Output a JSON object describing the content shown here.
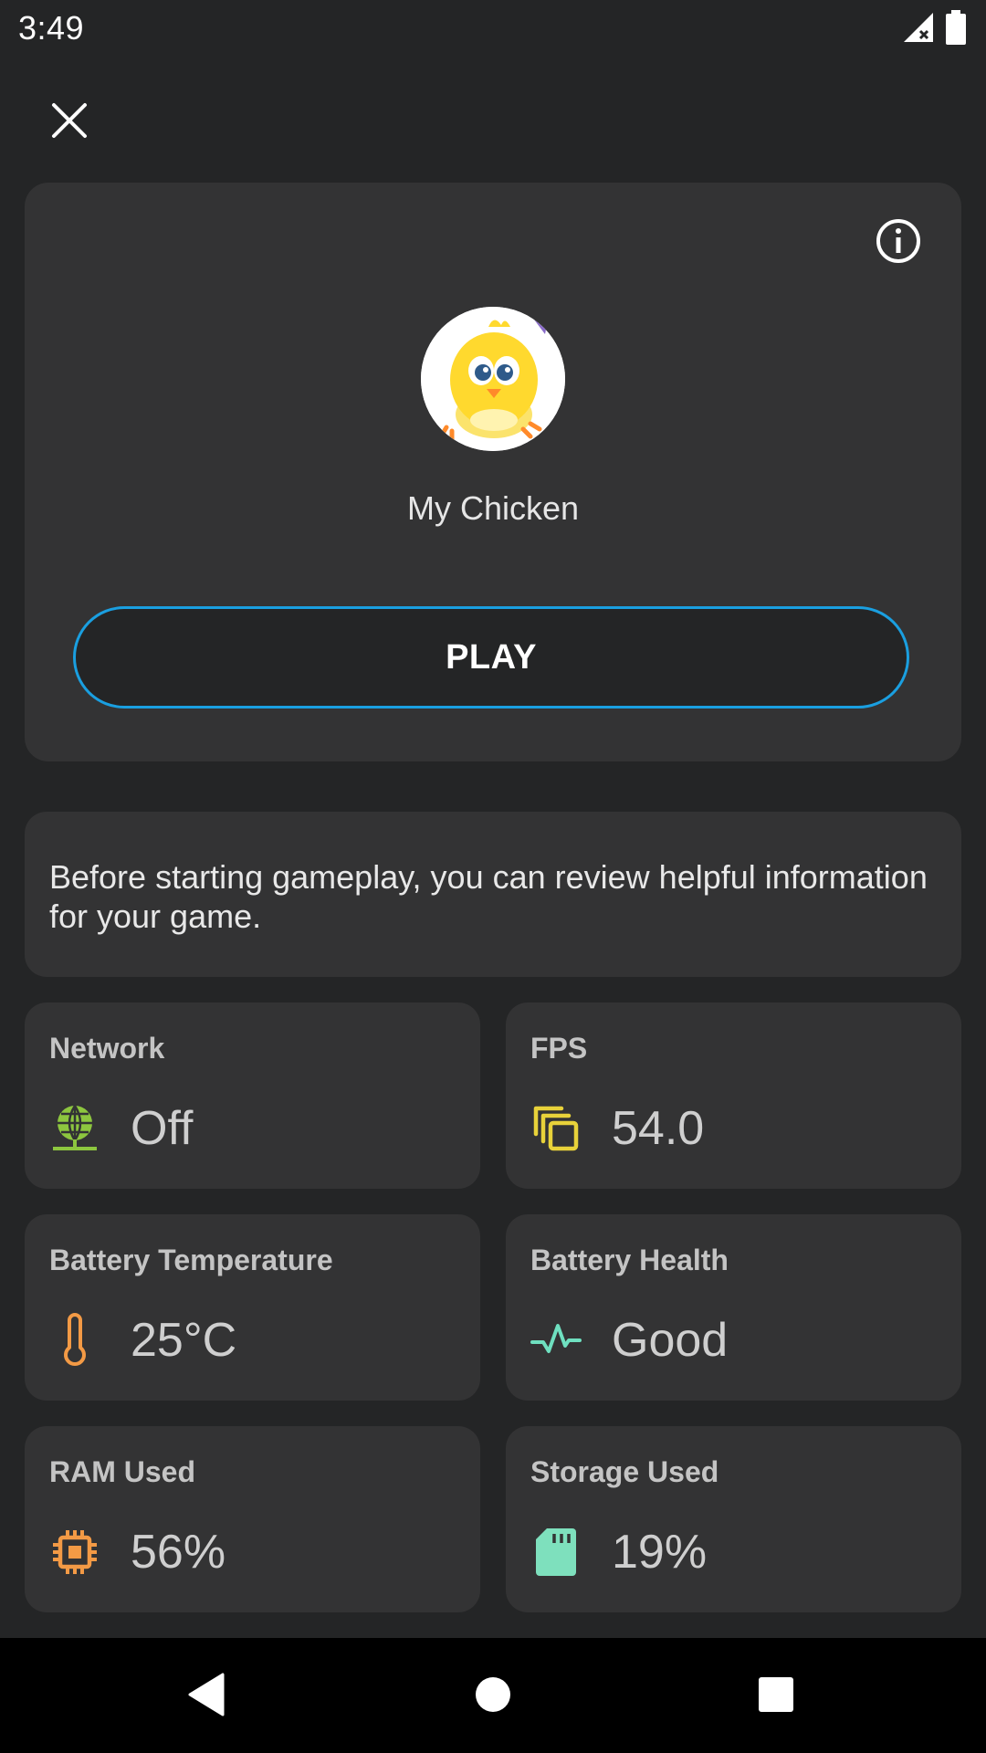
{
  "status_bar": {
    "time": "3:49",
    "icons": [
      "signal-no-data-icon",
      "battery-icon"
    ]
  },
  "header": {
    "close_icon": "close-icon"
  },
  "game": {
    "title": "My Chicken",
    "play_label": "PLAY",
    "info_icon": "info-icon",
    "accent_color": "#1a9fe0"
  },
  "info": {
    "text": "Before starting gameplay, you can review helpful information for your game."
  },
  "stats": {
    "network": {
      "label": "Network",
      "value": "Off",
      "icon": "network-globe-icon",
      "color": "#8dc63f"
    },
    "fps": {
      "label": "FPS",
      "value": "54.0",
      "icon": "fps-layers-icon",
      "color": "#e8d23a"
    },
    "battery_temperature": {
      "label": "Battery Temperature",
      "value": "25°C",
      "icon": "thermometer-icon",
      "color": "#f39a45"
    },
    "battery_health": {
      "label": "Battery Health",
      "value": "Good",
      "icon": "pulse-icon",
      "color": "#6fe0c0"
    },
    "ram_used": {
      "label": "RAM Used",
      "value": "56%",
      "icon": "chip-icon",
      "color": "#f39a45"
    },
    "storage_used": {
      "label": "Storage Used",
      "value": "19%",
      "icon": "sd-card-icon",
      "color": "#7ee0bd"
    }
  },
  "nav_bar": {
    "back_icon": "back-triangle-icon",
    "home_icon": "home-circle-icon",
    "recents_icon": "recents-square-icon"
  }
}
